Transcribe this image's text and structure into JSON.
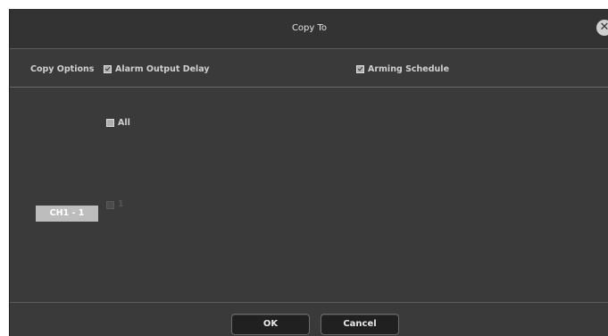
{
  "dialog": {
    "title": "Copy To",
    "close_symbol": "✕"
  },
  "options": {
    "label": "Copy Options",
    "alarm_output_delay": {
      "label": "Alarm Output Delay",
      "checked": true
    },
    "arming_schedule": {
      "label": "Arming Schedule",
      "checked": true
    }
  },
  "channels": {
    "all_label": "All",
    "all_checked": false,
    "source_channel": "CH1 - 1",
    "items": [
      {
        "label": "1",
        "checked": false,
        "disabled": true
      }
    ]
  },
  "buttons": {
    "ok_label": "OK",
    "cancel_label": "Cancel"
  },
  "colors": {
    "background": "#3a3a3a",
    "title_bar": "#333333",
    "button": "#202020"
  }
}
